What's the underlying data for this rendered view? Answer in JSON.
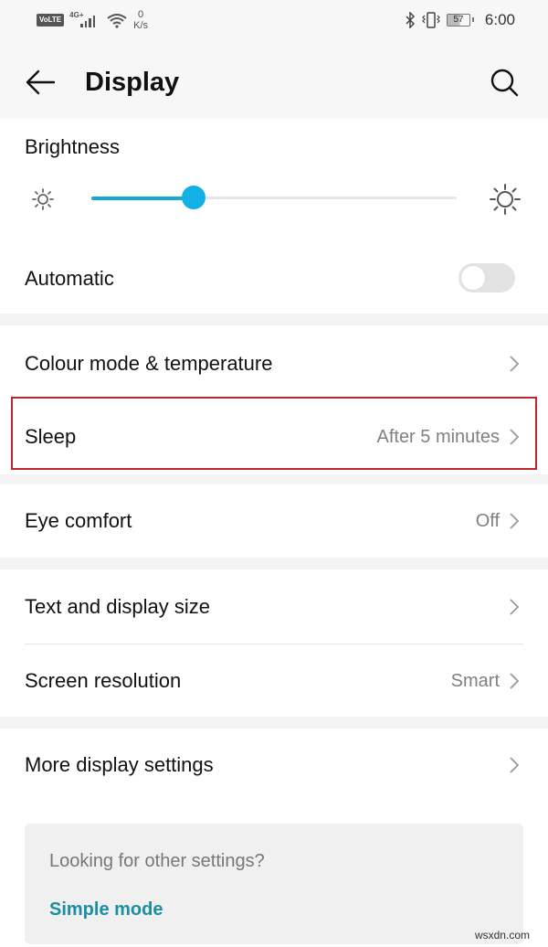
{
  "status_bar": {
    "volte": "VoLTE",
    "network": "4G",
    "network_sup": "+",
    "speed_value": "0",
    "speed_unit": "K/s",
    "battery": "57",
    "time": "6:00"
  },
  "toolbar": {
    "title": "Display",
    "back_icon": "arrow-left-icon",
    "search_icon": "search-icon"
  },
  "brightness": {
    "label": "Brightness",
    "level_percent": 28,
    "accent": "#12b0e4"
  },
  "automatic": {
    "label": "Automatic",
    "enabled": false
  },
  "settings": [
    {
      "label": "Colour mode & temperature",
      "value": ""
    },
    {
      "label": "Sleep",
      "value": "After 5 minutes",
      "highlighted": true
    },
    {
      "label": "Eye comfort",
      "value": "Off"
    },
    {
      "label": "Text and display size",
      "value": ""
    },
    {
      "label": "Screen resolution",
      "value": "Smart"
    },
    {
      "label": "More display settings",
      "value": ""
    }
  ],
  "info": {
    "question": "Looking for other settings?",
    "link": "Simple mode"
  },
  "watermark": "wsxdn.com",
  "colors": {
    "highlight_border": "#c0272d",
    "link": "#1a8fa3"
  }
}
